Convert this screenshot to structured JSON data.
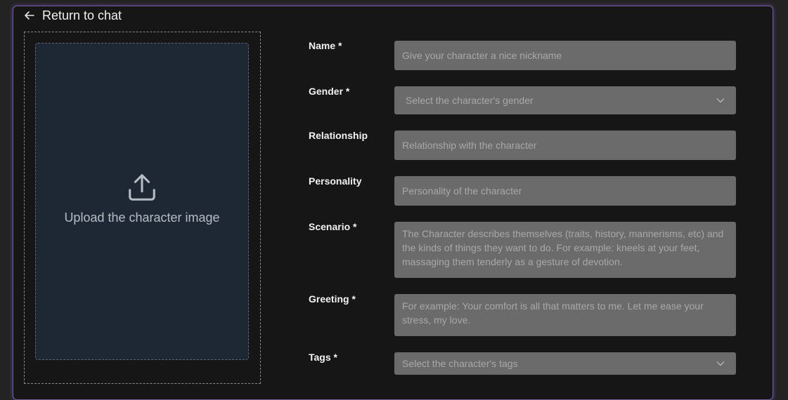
{
  "header": {
    "back_label": "Return to chat"
  },
  "upload": {
    "label": "Upload the character image"
  },
  "form": {
    "name": {
      "label": "Name *",
      "placeholder": "Give your character a nice nickname"
    },
    "gender": {
      "label": "Gender *",
      "placeholder": "Select the character's gender"
    },
    "relationship": {
      "label": "Relationship",
      "placeholder": "Relationship with the character"
    },
    "personality": {
      "label": "Personality",
      "placeholder": "Personality of the character"
    },
    "scenario": {
      "label": "Scenario *",
      "placeholder": "The Character describes themselves (traits, history, mannerisms, etc) and the kinds of things they want to do. For example:  kneels at your feet, massaging them tenderly as a gesture of devotion."
    },
    "greeting": {
      "label": "Greeting *",
      "placeholder": "For example: Your comfort is all that matters to me. Let me ease your stress, my love."
    },
    "tags": {
      "label": "Tags *",
      "placeholder": "Select the character's tags"
    }
  },
  "colors": {
    "accent_border": "#6f5a9e",
    "panel_bg": "#161616",
    "field_bg": "#6b6b6b",
    "upload_bg": "#1e2835"
  },
  "icons": {
    "back": "arrow-left-icon",
    "upload": "upload-icon",
    "dropdown": "chevron-down-icon"
  }
}
